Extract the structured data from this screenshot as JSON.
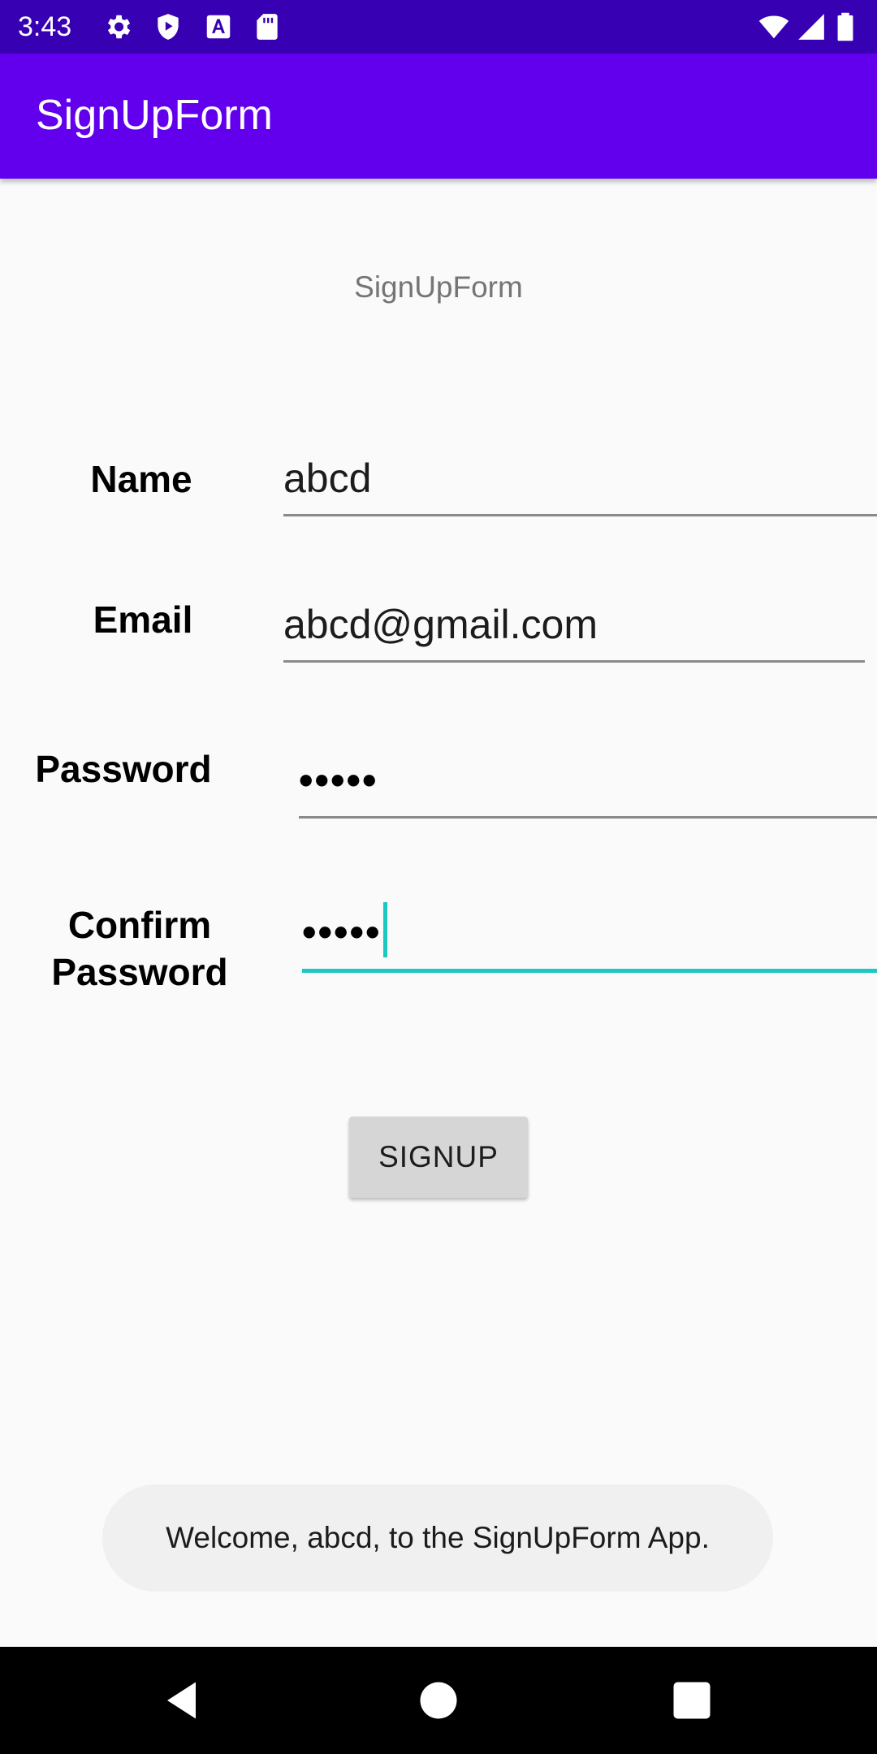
{
  "status_bar": {
    "time": "3:43",
    "left_icons": [
      "gear-icon",
      "shield-play-icon",
      "text-a-icon",
      "sd-card-icon"
    ],
    "right_icons": [
      "wifi-icon",
      "signal-icon",
      "battery-icon"
    ]
  },
  "app_bar": {
    "title": "SignUpForm"
  },
  "screen": {
    "subtitle": "SignUpForm",
    "name_label": "Name",
    "name_value": "abcd",
    "email_label": "Email",
    "email_value": "abcd@gmail.com",
    "password_label": "Password",
    "password_value": "•••••",
    "confirm_label_line1": "Confirm",
    "confirm_label_line2": "Password",
    "confirm_value": "•••••",
    "signup_label": "SIGNUP"
  },
  "toast": {
    "message": "Welcome, abcd, to the SignUpForm App."
  },
  "nav_bar": {
    "icons": [
      "back-icon",
      "home-icon",
      "recents-icon"
    ]
  },
  "colors": {
    "status_bar": "#3700b3",
    "app_bar": "#6200ee",
    "focus_accent": "#1bc9c0",
    "button": "#d6d6d6"
  }
}
